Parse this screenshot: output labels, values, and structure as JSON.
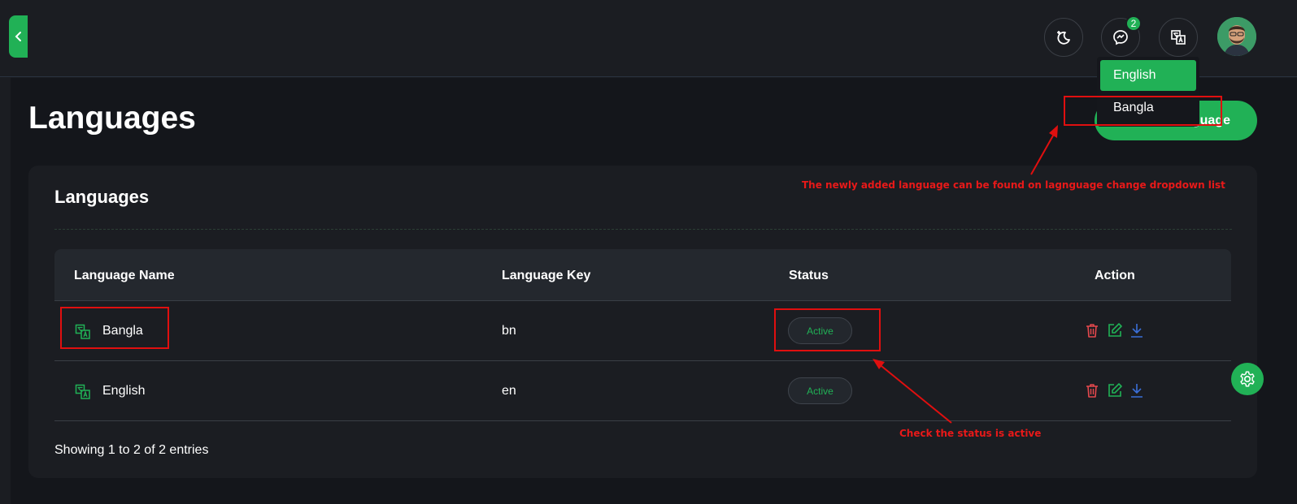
{
  "header": {
    "notification_count": "2",
    "icons": [
      "chevron-left-icon",
      "moon-stars-icon",
      "messenger-icon",
      "translate-icon"
    ]
  },
  "page": {
    "title": "Languages",
    "add_button_label": "Add Language",
    "add_button_visible_label": "guage"
  },
  "card": {
    "title": "Languages",
    "columns": [
      "Language Name",
      "Language Key",
      "Status",
      "Action"
    ],
    "rows": [
      {
        "name": "Bangla",
        "key": "bn",
        "status": "Active"
      },
      {
        "name": "English",
        "key": "en",
        "status": "Active"
      }
    ],
    "footer": "Showing 1 to 2 of 2 entries"
  },
  "language_dropdown": {
    "items": [
      "English",
      "Bangla"
    ],
    "selected": "English"
  },
  "annotations": {
    "dropdown_note": "The newly added language can be found on lagnguage change dropdown list",
    "status_note": "Check the status is active"
  },
  "colors": {
    "accent": "#21b156",
    "background": "#1b1d22",
    "annotation": "#e00f0f",
    "delete": "#e5484d",
    "download": "#3b6fd8"
  }
}
